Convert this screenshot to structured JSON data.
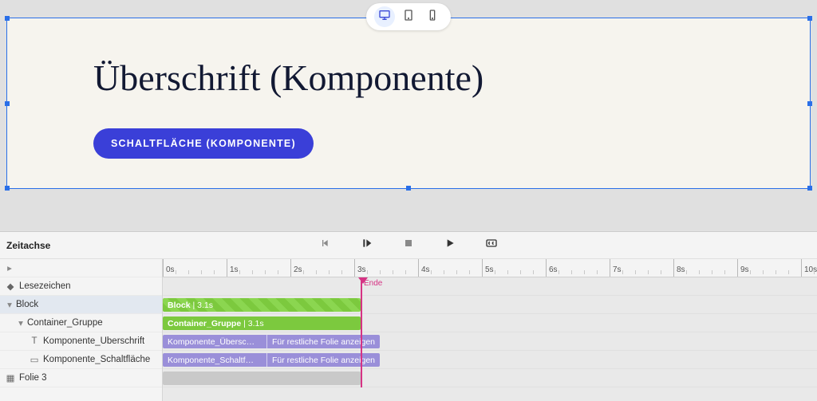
{
  "device_toolbar": {
    "active": "desktop"
  },
  "canvas": {
    "heading": "Überschrift (Komponente)",
    "button_label": "SCHALTFLÄCHE (KOMPONENTE)"
  },
  "timeline": {
    "title": "Zeitachse",
    "end_label": "Ende",
    "pixels_per_second": 80,
    "playhead_seconds": 3.1,
    "ruler_labels": [
      "0s",
      "1s",
      "2s",
      "3s",
      "4s",
      "5s",
      "6s",
      "7s",
      "8s",
      "9s",
      "10s"
    ],
    "rows": [
      {
        "name_key": "expander",
        "label": "",
        "icon": "chevron-right",
        "indent": 0
      },
      {
        "name_key": "bookmarks",
        "label": "Lesezeichen",
        "icon": "diamond",
        "indent": 0
      },
      {
        "name_key": "block",
        "label": "Block",
        "icon": "chevron-down",
        "indent": 0,
        "selected": true
      },
      {
        "name_key": "container-group",
        "label": "Container_Gruppe",
        "icon": "chevron-down",
        "indent": 1
      },
      {
        "name_key": "comp-heading",
        "label": "Komponente_Überschrift",
        "icon": "text",
        "indent": 2
      },
      {
        "name_key": "comp-button",
        "label": "Komponente_Schaltfläche",
        "icon": "button",
        "indent": 2
      },
      {
        "name_key": "slide-3",
        "label": "Folie 3",
        "icon": "slide",
        "indent": 0
      }
    ],
    "tracks": {
      "block": {
        "label_a": "Block",
        "label_b": "| 3.1s",
        "width_s": 3.1,
        "style": "green-hatch"
      },
      "container": {
        "label_a": "Container_Gruppe",
        "label_b": "| 3.1s",
        "width_s": 3.1,
        "style": "green"
      },
      "heading": {
        "seg1": "Komponente_Übersc…",
        "seg2": "Für restliche Folie anzeigen",
        "split_s": 1.75,
        "width_s": 3.4,
        "style": "purple"
      },
      "button": {
        "seg1": "Komponente_Schaltf…",
        "seg2": "Für restliche Folie anzeigen",
        "split_s": 1.75,
        "width_s": 3.4,
        "style": "purple"
      },
      "slide": {
        "width_s": 3.1,
        "style": "grey"
      }
    }
  }
}
